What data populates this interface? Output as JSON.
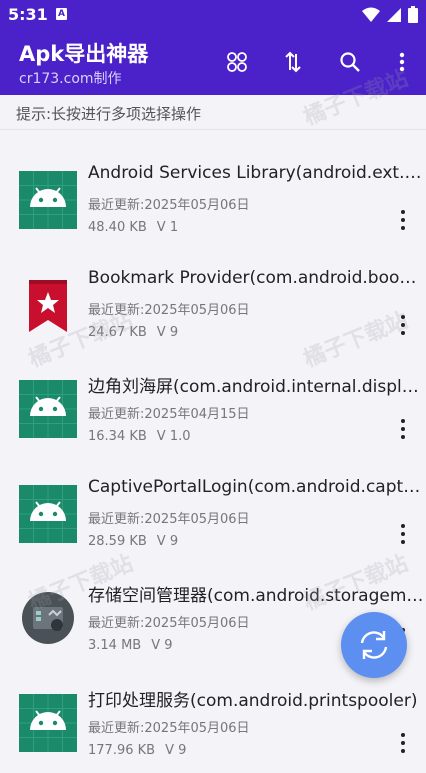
{
  "status_bar": {
    "time": "5:31",
    "notification_badge": "A"
  },
  "app_bar": {
    "title": "Apk导出神器",
    "subtitle": "cr173.com制作",
    "actions": [
      "grid-view-icon",
      "sort-icon",
      "search-icon",
      "more-vert-icon"
    ]
  },
  "hint": "提示:长按进行多项选择操作",
  "apps": [
    {
      "name": "Android Services Library(android.ext.services)",
      "date": "最近更新:2025年05月06日",
      "size": "48.40 KB",
      "version": "V 1",
      "icon": "android-icon"
    },
    {
      "name": "Bookmark Provider(com.android.bookmarkprovider)",
      "date": "最近更新:2025年05月06日",
      "size": "24.67 KB",
      "version": "V 9",
      "icon": "bookmark-icon"
    },
    {
      "name": "边角刘海屏(com.android.internal.display.cutout)",
      "date": "最近更新:2025年04月15日",
      "size": "16.34 KB",
      "version": "V 1.0",
      "icon": "android-icon"
    },
    {
      "name": "CaptivePortalLogin(com.android.captiveportallogin)",
      "date": "最近更新:2025年05月06日",
      "size": "28.59 KB",
      "version": "V 9",
      "icon": "android-icon"
    },
    {
      "name": "存储空间管理器(com.android.storagemanager)",
      "date": "最近更新:2025年05月06日",
      "size": "3.14 MB",
      "version": "V 9",
      "icon": "storage-manager-icon"
    },
    {
      "name": "打印处理服务(com.android.printspooler)",
      "date": "最近更新:2025年05月06日",
      "size": "177.96 KB",
      "version": "V 9",
      "icon": "android-icon"
    }
  ],
  "fab": {
    "icon": "refresh-icon"
  },
  "watermark": "橘子下载站",
  "colors": {
    "app_bar": "#4b22c9",
    "fab": "#5d8ff0",
    "android_icon_bg": "#1a8a6a"
  }
}
